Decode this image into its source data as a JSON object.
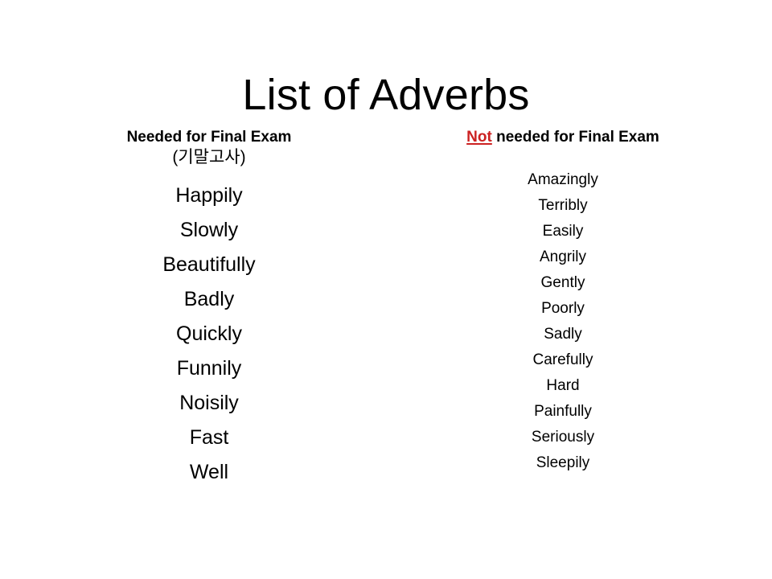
{
  "slide": {
    "title": "List of Adverbs",
    "background_color": "#FFFFFF",
    "text_color": "#000000",
    "accent_color": "#CC2222"
  },
  "columns": {
    "left": {
      "header_main": "Needed for Final Exam",
      "header_sub": "(기말고사)",
      "items": [
        "Happily",
        "Slowly",
        "Beautifully",
        "Badly",
        "Quickly",
        "Funnily",
        "Noisily",
        "Fast",
        "Well"
      ]
    },
    "right": {
      "header_negation": "Not",
      "header_rest": " needed for Final Exam",
      "items": [
        "Amazingly",
        "Terribly",
        "Easily",
        "Angrily",
        "Gently",
        "Poorly",
        "Sadly",
        "Carefully",
        "Hard",
        "Painfully",
        "Seriously",
        "Sleepily"
      ]
    }
  }
}
